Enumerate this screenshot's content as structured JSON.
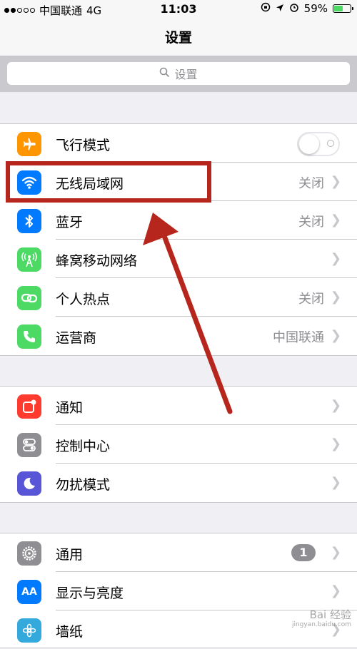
{
  "status_bar": {
    "carrier": "中国联通",
    "network": "4G",
    "time": "11:03",
    "battery_percent": "59%",
    "battery_level": 0.59
  },
  "nav": {
    "title": "设置"
  },
  "search": {
    "placeholder": "设置"
  },
  "groups": [
    {
      "rows": [
        {
          "label": "飞行模式",
          "icon": "airplane-icon",
          "color": "#ff9500",
          "control": "toggle",
          "toggle_on": false
        },
        {
          "label": "无线局域网",
          "icon": "wifi-icon",
          "color": "#007aff",
          "value": "关闭"
        },
        {
          "label": "蓝牙",
          "icon": "bluetooth-icon",
          "color": "#007aff",
          "value": "关闭"
        },
        {
          "label": "蜂窝移动网络",
          "icon": "cellular-icon",
          "color": "#4cd964",
          "value": ""
        },
        {
          "label": "个人热点",
          "icon": "hotspot-icon",
          "color": "#4cd964",
          "value": "关闭"
        },
        {
          "label": "运营商",
          "icon": "phone-icon",
          "color": "#4cd964",
          "value": "中国联通"
        }
      ]
    },
    {
      "rows": [
        {
          "label": "通知",
          "icon": "notification-icon",
          "color": "#ff3b30"
        },
        {
          "label": "控制中心",
          "icon": "control-center-icon",
          "color": "#8e8e93"
        },
        {
          "label": "勿扰模式",
          "icon": "moon-icon",
          "color": "#5856d6"
        }
      ]
    },
    {
      "rows": [
        {
          "label": "通用",
          "icon": "gear-icon",
          "color": "#8e8e93",
          "badge": "1"
        },
        {
          "label": "显示与亮度",
          "icon": "display-icon",
          "color": "#007aff",
          "icon_text": "AA"
        },
        {
          "label": "墙纸",
          "icon": "wallpaper-icon",
          "color": "#34aadc"
        }
      ]
    }
  ],
  "watermark": {
    "text": "Bai 经验",
    "sub": "jingyan.baidu.com"
  },
  "colors": {
    "annotation": "#b7261d"
  }
}
